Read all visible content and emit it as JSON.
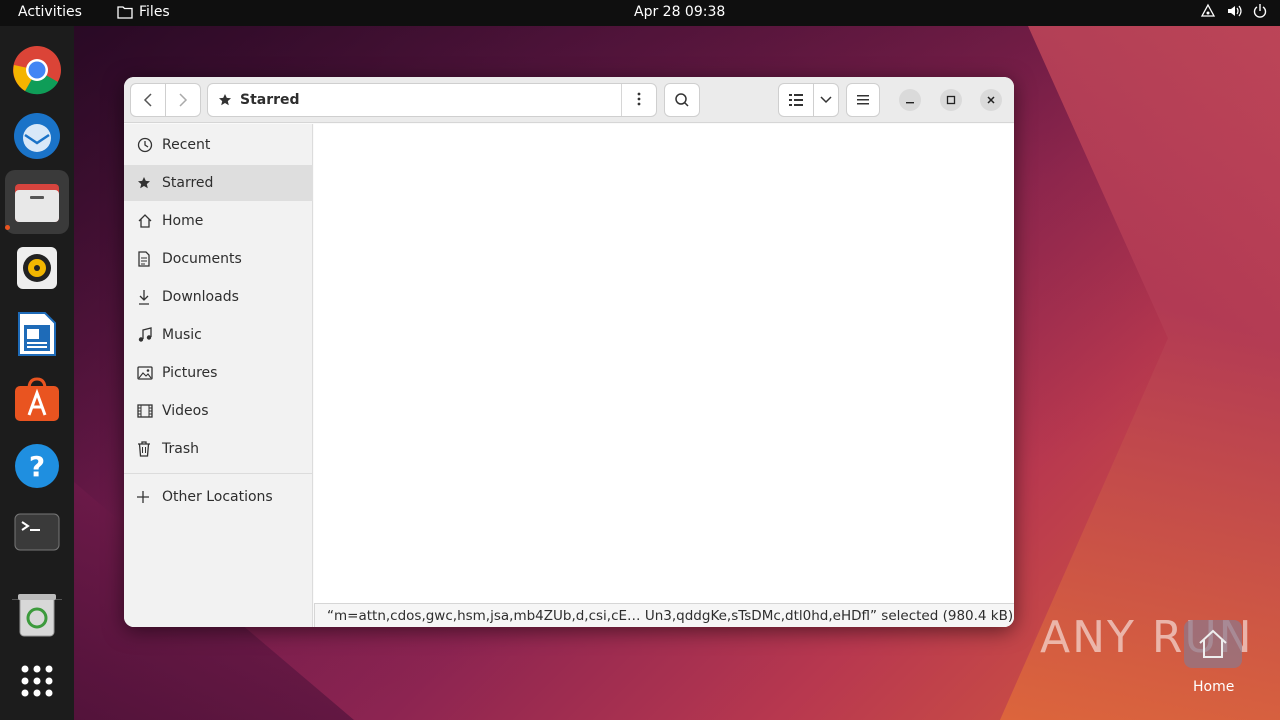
{
  "topbar": {
    "activities": "Activities",
    "app_name": "Files",
    "clock": "Apr 28  09:38"
  },
  "dock": {
    "items": [
      "chrome-icon",
      "thunderbird-icon",
      "files-icon",
      "rhythmbox-icon",
      "libreoffice-writer-icon",
      "app-center-icon",
      "help-icon",
      "terminal-icon",
      "trash-icon",
      "app-grid-icon"
    ]
  },
  "window": {
    "location": "Starred",
    "sidebar": {
      "items": [
        {
          "label": "Recent",
          "icon": "clock-icon"
        },
        {
          "label": "Starred",
          "icon": "star-icon"
        },
        {
          "label": "Home",
          "icon": "home-icon"
        },
        {
          "label": "Documents",
          "icon": "document-icon"
        },
        {
          "label": "Downloads",
          "icon": "download-icon"
        },
        {
          "label": "Music",
          "icon": "music-icon"
        },
        {
          "label": "Pictures",
          "icon": "picture-icon"
        },
        {
          "label": "Videos",
          "icon": "video-icon"
        },
        {
          "label": "Trash",
          "icon": "trash-icon"
        }
      ],
      "other": "Other Locations"
    },
    "status": "“m=attn,cdos,gwc,hsm,jsa,mb4ZUb,d,csi,cE… Un3,qddgKe,sTsDMc,dtl0hd,eHDfl” selected  (980.4 kB)"
  },
  "desktop": {
    "watermark": "ANY RUN",
    "home_label": "Home"
  },
  "colors": {
    "accent": "#e95420",
    "topbar": "#0f0f0f",
    "dock": "#1c1c1c"
  }
}
